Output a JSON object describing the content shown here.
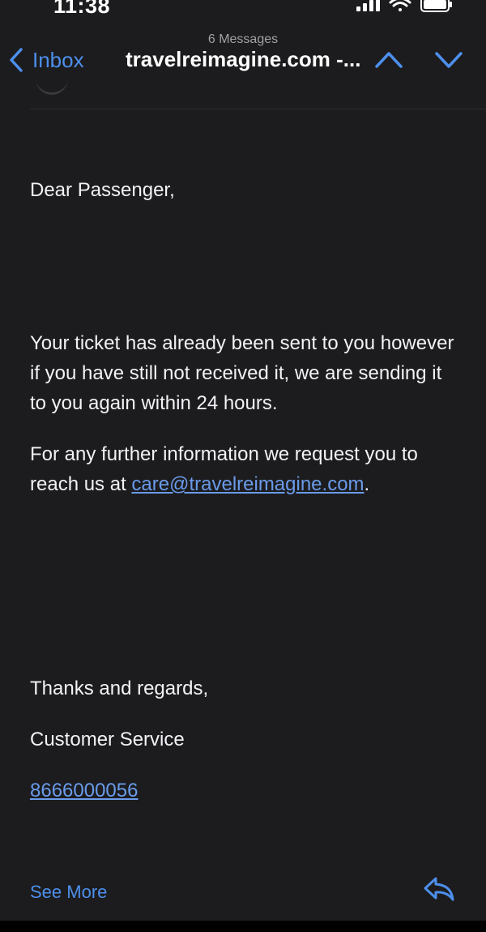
{
  "status_bar": {
    "time": "11:38",
    "icons": [
      "cellular-signal-icon",
      "wifi-icon",
      "battery-icon"
    ]
  },
  "nav": {
    "back_label": "Inbox",
    "message_count": "6 Messages",
    "title": "travelreimagine.com -...",
    "icons": [
      "chevron-left-icon",
      "chevron-up-icon",
      "chevron-down-icon"
    ]
  },
  "email": {
    "greeting": "Dear Passenger,",
    "paragraph1": "Your ticket has already been sent to you however if you have still not received it, we are sending it to you again within 24 hours.",
    "paragraph2_prefix": "For any further information we request you to reach us at ",
    "paragraph2_link": "care@travelreimagine.com",
    "paragraph2_suffix": ".",
    "closing": "Thanks and regards,",
    "signature": "Customer Service",
    "phone": "8666000056"
  },
  "footer": {
    "see_more_label": "See More",
    "reply_icon": "reply-icon"
  },
  "colors": {
    "background": "#1c1c1e",
    "accent": "#4d8fec",
    "link": "#6a9bea",
    "text": "#f2f2f7"
  }
}
